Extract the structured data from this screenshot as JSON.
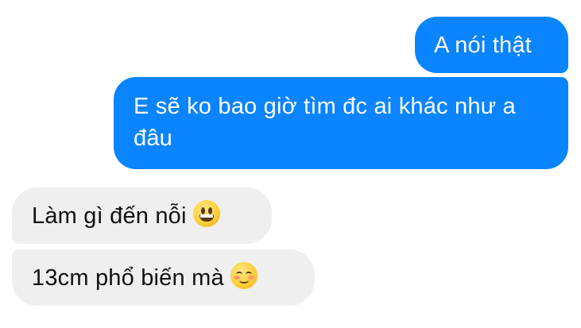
{
  "messages": [
    {
      "direction": "outgoing",
      "text": "A nói thật"
    },
    {
      "direction": "outgoing",
      "text": "E sẽ ko bao giờ tìm đc ai khác như a đâu"
    },
    {
      "direction": "incoming",
      "text": "Làm gì đến nỗi",
      "emoji": "grinning-face-icon"
    },
    {
      "direction": "incoming",
      "text": "13cm phổ biến mà",
      "emoji": "smiling-face-icon"
    }
  ],
  "colors": {
    "outgoing_bubble": "#0a84ff",
    "incoming_bubble": "#efefef",
    "outgoing_text": "#ffffff",
    "incoming_text": "#111111"
  }
}
